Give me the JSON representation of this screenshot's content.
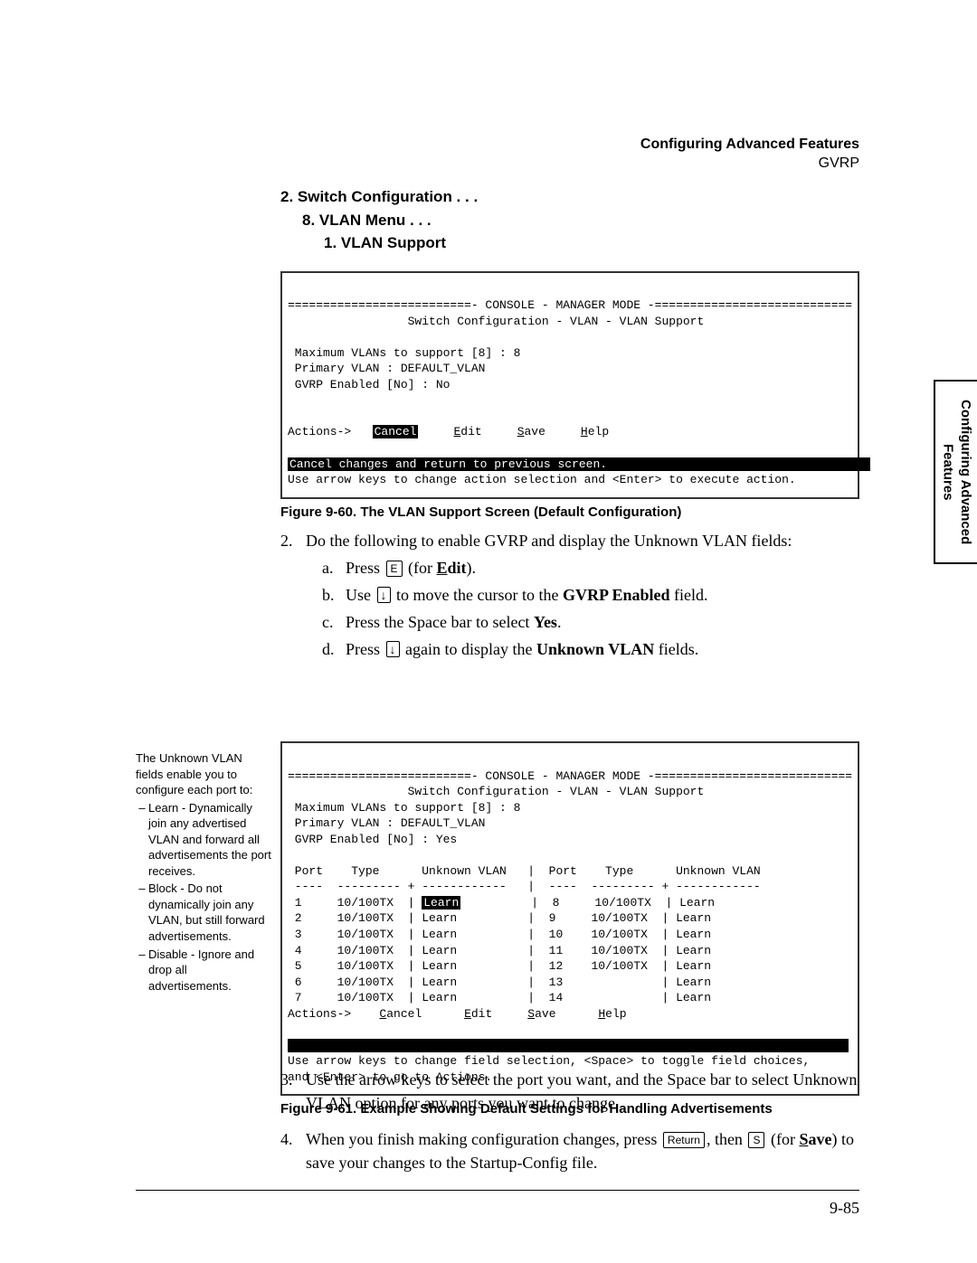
{
  "header": {
    "title": "Configuring Advanced Features",
    "subtitle": "GVRP"
  },
  "side_tab": "Configuring Advanced\nFeatures",
  "menu_path": {
    "l1": "2. Switch Configuration . . .",
    "l2": "8. VLAN Menu . . .",
    "l3": "1. VLAN Support"
  },
  "console1": {
    "line1": "==========================- CONSOLE - MANAGER MODE -============================",
    "line2": "                 Switch Configuration - VLAN - VLAN Support",
    "line3": " Maximum VLANs to support [8] : 8",
    "line4": " Primary VLAN : DEFAULT_VLAN",
    "line5": " GVRP Enabled [No] : No",
    "actions_prefix": "Actions->   ",
    "cancel": "Cancel",
    "edit": "Edit",
    "save": "Save",
    "help": "Help",
    "status_bar": "Cancel changes and return to previous screen.                                     ",
    "hint": "Use arrow keys to change action selection and <Enter> to execute action."
  },
  "figcaption1": "Figure 9-60.  The VLAN Support Screen (Default Configuration)",
  "step2_intro": "Do the following to enable GVRP and display the Unknown VLAN fields:",
  "step2": {
    "a1": "Press ",
    "a_key": "E",
    "a2": " (for ",
    "a_bold": "Edit",
    "a3": ").",
    "b1": "Use ",
    "b2": " to move the cursor to the ",
    "b_bold": "GVRP Enabled",
    "b3": " field.",
    "c1": "Press the Space bar to select ",
    "c_bold": "Yes",
    "c2": ".",
    "d1": "Press ",
    "d2": " again to display the ",
    "d_bold": "Unknown VLAN",
    "d3": " fields."
  },
  "sidenote": {
    "intro": "The Unknown VLAN fields enable you to configure each port to:",
    "i1": "Learn - Dynamically join any advertised VLAN and forward all advertisements the port receives.",
    "i2": "Block - Do not dynamically join any VLAN, but still forward advertisements.",
    "i3": "Disable - Ignore and drop all advertisements."
  },
  "console2": {
    "line1": "==========================- CONSOLE - MANAGER MODE -============================",
    "line2": "                 Switch Configuration - VLAN - VLAN Support",
    "line3": " Maximum VLANs to support [8] : 8",
    "line4": " Primary VLAN : DEFAULT_VLAN",
    "line5": " GVRP Enabled [No] : Yes",
    "hdr": " Port    Type      Unknown VLAN   |  Port    Type      Unknown VLAN",
    "sep": " ----  --------- + ------------   |  ----  --------- + ------------",
    "r1l": " 1     10/100TX  | ",
    "r1l_sel": "Learn",
    "r1r": "          |  8     10/100TX  | Learn",
    "r2": " 2     10/100TX  | Learn          |  9     10/100TX  | Learn",
    "r3": " 3     10/100TX  | Learn          |  10    10/100TX  | Learn",
    "r4": " 4     10/100TX  | Learn          |  11    10/100TX  | Learn",
    "r5": " 5     10/100TX  | Learn          |  12    10/100TX  | Learn",
    "r6": " 6     10/100TX  | Learn          |  13              | Learn",
    "r7": " 7     10/100TX  | Learn          |  14              | Learn",
    "actions": "Actions->    Cancel      Edit     Save      Help",
    "status_bar": "                                                                               ",
    "hint1": "Use arrow keys to change field selection, <Space> to toggle field choices,",
    "hint2": "and <Enter> to go to Actions."
  },
  "figcaption2": "Figure 9-61.  Example Showing Default Settings for Handling Advertisements",
  "step3": "Use the arrow keys to select the port you want, and the Space bar to select Unknown VLAN option for any ports you want to change.",
  "step4": {
    "p1": "When you finish making configuration changes, press ",
    "k1": "Return",
    "p2": ", then ",
    "k2": "S",
    "p3": " (for ",
    "bold": "Save",
    "p4": ") to save your changes to the Startup-Config file."
  },
  "page_num": "9-85"
}
